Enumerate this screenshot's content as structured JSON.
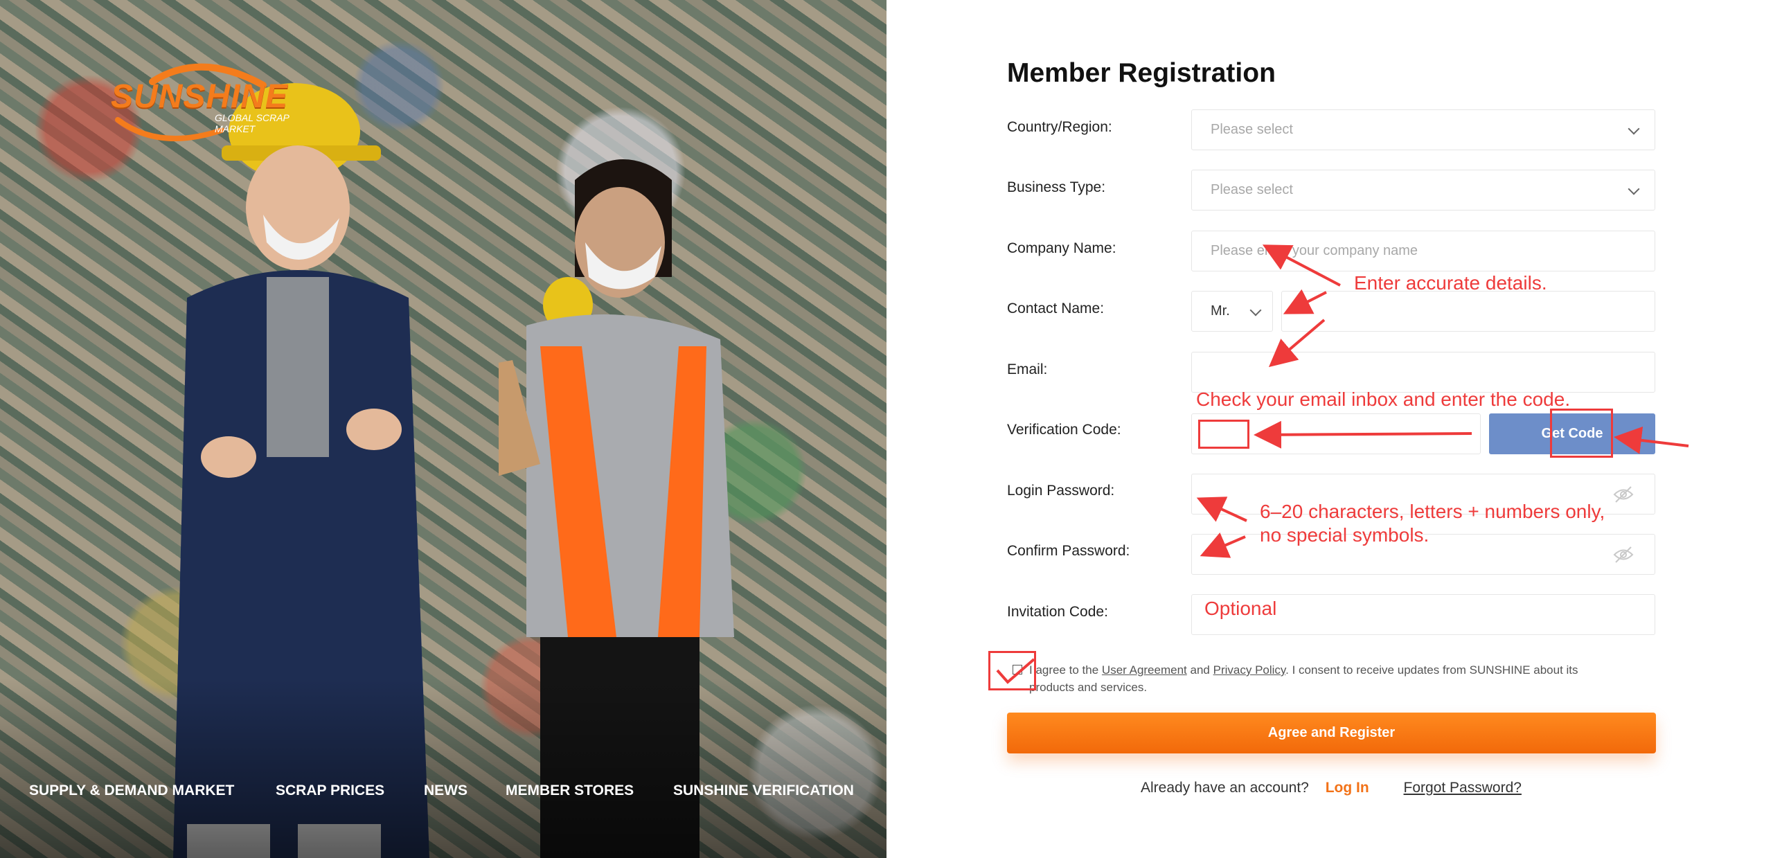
{
  "brand": {
    "logo_word": "SUNSHINE",
    "logo_sub_line1": "GLOBAL SCRAP",
    "logo_sub_line2": "MARKET",
    "accent_color": "#f47c1c"
  },
  "nav": {
    "items": [
      {
        "label": "SUPPLY & DEMAND MARKET"
      },
      {
        "label": "SCRAP PRICES"
      },
      {
        "label": "NEWS"
      },
      {
        "label": "MEMBER STORES"
      },
      {
        "label": "SUNSHINE VERIFICATION"
      }
    ]
  },
  "form": {
    "title": "Member Registration",
    "country": {
      "label": "Country/Region:",
      "placeholder": "Please select"
    },
    "business": {
      "label": "Business Type:",
      "placeholder": "Please select"
    },
    "company": {
      "label": "Company Name:",
      "placeholder": "Please enter your company name"
    },
    "contact": {
      "label": "Contact Name:",
      "title_value": "Mr.",
      "value": ""
    },
    "email": {
      "label": "Email:",
      "value": ""
    },
    "verification": {
      "label": "Verification Code:",
      "value": "",
      "button": "Get Code"
    },
    "login_password": {
      "label": "Login Password:",
      "value": ""
    },
    "confirm_password": {
      "label": "Confirm Password:",
      "value": ""
    },
    "invitation": {
      "label": "Invitation Code:",
      "value": ""
    },
    "agreement": {
      "prefix": "I agree to the",
      "user_agreement": "User Agreement",
      "and": "and",
      "privacy_policy": "Privacy Policy",
      "suffix": ". I consent to receive updates from SUNSHINE about its products and services.",
      "checked": false
    },
    "register_button": "Agree and Register",
    "have_account": "Already have an account?",
    "login": "Log In",
    "forgot": "Forgot Password?",
    "primary_button_color": "#f2690a",
    "code_button_color": "#6d8ec9"
  },
  "annotations": {
    "accurate": "Enter accurate details.",
    "check_email": "Check your email inbox and enter the code.",
    "password_rule_line1": "6–20 characters, letters + numbers only,",
    "password_rule_line2": "no special symbols.",
    "optional": "Optional",
    "color": "#ee3b3b"
  }
}
